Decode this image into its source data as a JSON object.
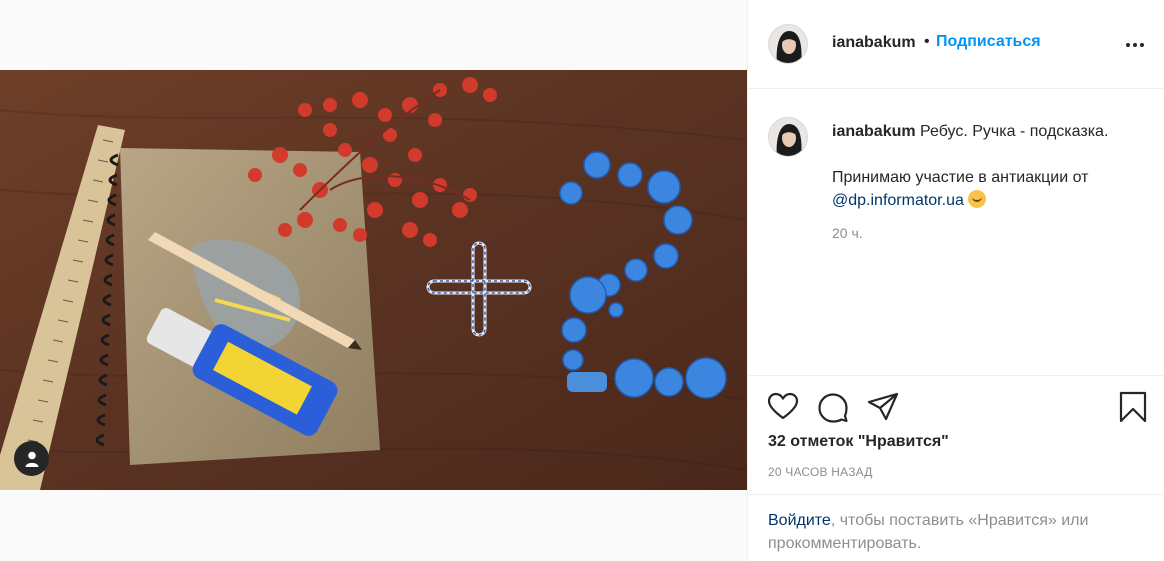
{
  "post": {
    "media_alt": "",
    "header": {
      "username": "ianabakum",
      "separator": "•",
      "follow_label": "Подписаться",
      "more_icon": "more-horizontal-icon"
    },
    "caption": {
      "username": "ianabakum",
      "line1": "Ребус. Ручка - подсказка.",
      "line2_prefix": "Принимаю участие в антиакции от",
      "mention": "@dp.informator.ua",
      "emoji": "hugging-face-emoji",
      "time": "20 ч."
    },
    "actions": {
      "like_icon": "heart-icon",
      "comment_icon": "comment-icon",
      "share_icon": "share-icon",
      "save_icon": "bookmark-icon"
    },
    "likes": "32 отметок \"Нравится\"",
    "posted_ago": "20 ЧАСОВ НАЗАД",
    "login_prompt": {
      "link": "Войдите",
      "rest": ", чтобы поставить «Нравится» или прокомментировать."
    },
    "colors": {
      "accent": "#0095f6",
      "link": "#00376b",
      "muted": "#8e8e8e"
    }
  }
}
